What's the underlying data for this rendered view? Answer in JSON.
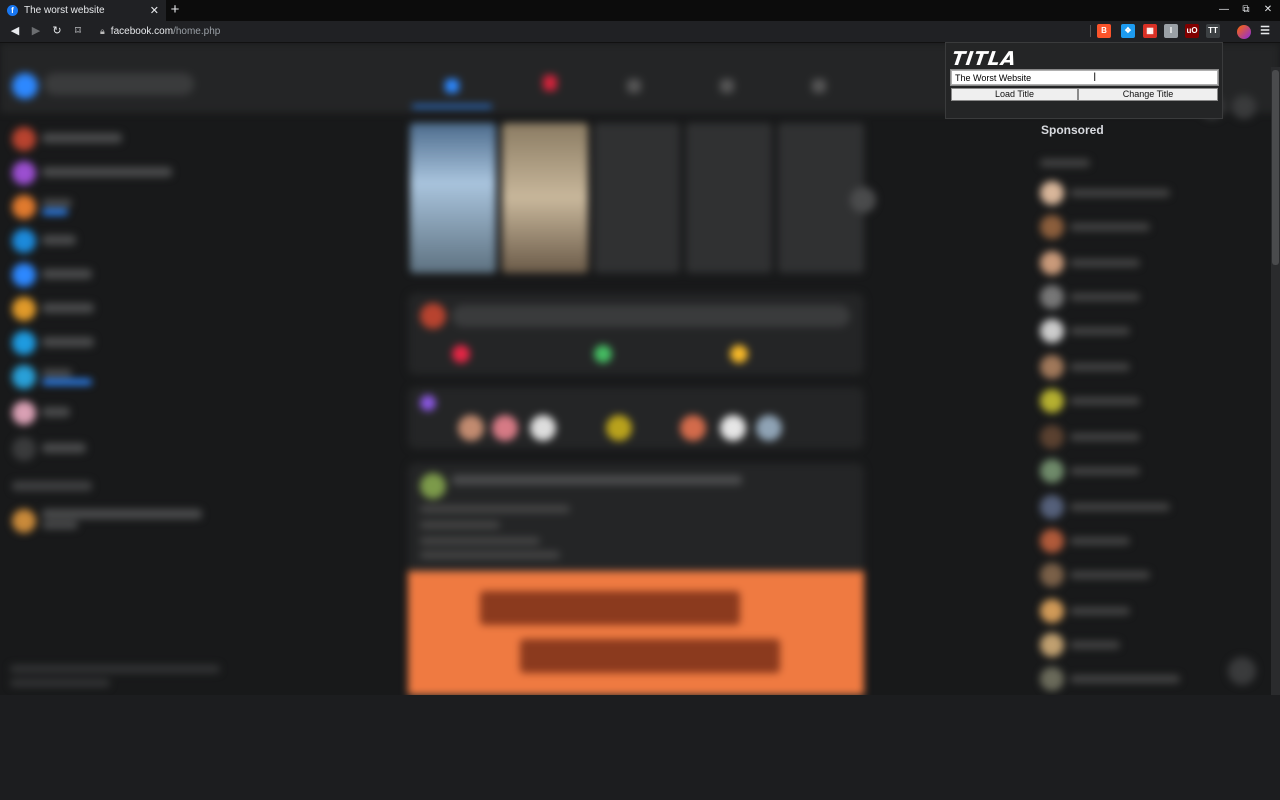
{
  "browser": {
    "tab": {
      "title": "The worst website",
      "favicon": "f",
      "close": "✕"
    },
    "new_tab": "+",
    "window_controls": {
      "minimize": "—",
      "restore": "⧉",
      "close": "✕"
    },
    "nav": {
      "back": "◀",
      "forward": "▶",
      "reload": "↻",
      "bookmark": "⌑"
    },
    "url": {
      "host": "facebook.com",
      "path": "/home.php"
    }
  },
  "extensions": [
    {
      "name": "brave-shield-icon",
      "label": "B",
      "color": "#fb542b"
    },
    {
      "name": "bluebird-extension-icon",
      "label": "❖",
      "color": "#1d9bf0"
    },
    {
      "name": "red-counter-extension-icon",
      "label": "▦",
      "color": "#d93025"
    },
    {
      "name": "info-extension-icon",
      "label": "I",
      "color": "#9aa0a6"
    },
    {
      "name": "ublock-extension-icon",
      "label": "uO",
      "color": "#800000"
    },
    {
      "name": "titla-extension-icon",
      "label": "TT",
      "color": "#3c4043"
    }
  ],
  "page": {
    "sponsored": "Sponsored"
  },
  "titla": {
    "logo": "TITLA",
    "input_value": "The Worst Website",
    "load_button": "Load Title",
    "change_button": "Change Title"
  },
  "colors": {
    "page_bg": "#18191a",
    "surface": "#242526",
    "accent": "#1877f2"
  }
}
